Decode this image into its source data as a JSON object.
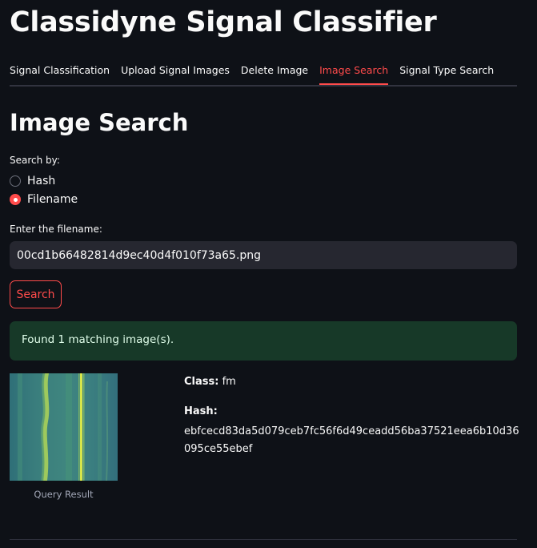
{
  "app": {
    "title": "Classidyne Signal Classifier"
  },
  "tabs": [
    {
      "label": "Signal Classification",
      "active": false
    },
    {
      "label": "Upload Signal Images",
      "active": false
    },
    {
      "label": "Delete Image",
      "active": false
    },
    {
      "label": "Image Search",
      "active": true
    },
    {
      "label": "Signal Type Search",
      "active": false
    }
  ],
  "main": {
    "title": "Image Search",
    "search_by": {
      "label": "Search by:",
      "options": [
        {
          "label": "Hash",
          "checked": false
        },
        {
          "label": "Filename",
          "checked": true
        }
      ]
    },
    "filename_input": {
      "label": "Enter the filename:",
      "value": "00cd1b66482814d9ec40d4f010f73a65.png"
    },
    "search_button": {
      "label": "Search"
    },
    "result_message": "Found 1 matching image(s).",
    "result": {
      "caption": "Query Result",
      "class_label": "Class:",
      "class_value": "fm",
      "hash_label": "Hash:",
      "hash_value": "ebfcecd83da5d079ceb7fc56f6d49ceadd56ba37521eea6b10d36095ce55ebef"
    }
  },
  "colors": {
    "background": "#0e1117",
    "accent": "#ff4b4b",
    "input_bg": "#262730",
    "success_bg": "#173928",
    "success_text": "#dffde9"
  }
}
